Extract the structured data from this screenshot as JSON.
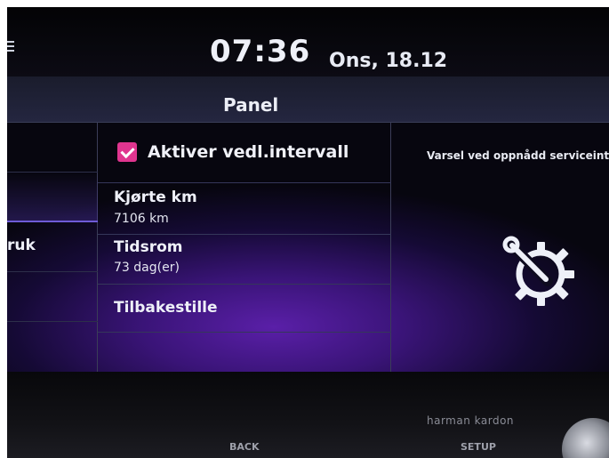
{
  "status": {
    "time": "07:36",
    "date": "Ons, 18.12"
  },
  "header": {
    "title": "Panel"
  },
  "left_menu": {
    "partial_label": "ruk"
  },
  "settings": {
    "enable_interval": {
      "label": "Aktiver vedl.intervall",
      "checked": true
    },
    "driven_km": {
      "title": "Kjørte km",
      "value": "7106 km"
    },
    "period": {
      "title": "Tidsrom",
      "value": "73 dag(er)"
    },
    "reset": {
      "label": "Tilbakestille"
    }
  },
  "info_panel": {
    "caption": "Varsel ved oppnådd serviceint",
    "icon": "wrench-gear-icon"
  },
  "hardware": {
    "brand": "harman kardon",
    "buttons": [
      "BACK",
      "SETUP"
    ]
  },
  "colors": {
    "accent_checkbox": "#e0358f",
    "background_glow": "#5a1fa8"
  }
}
